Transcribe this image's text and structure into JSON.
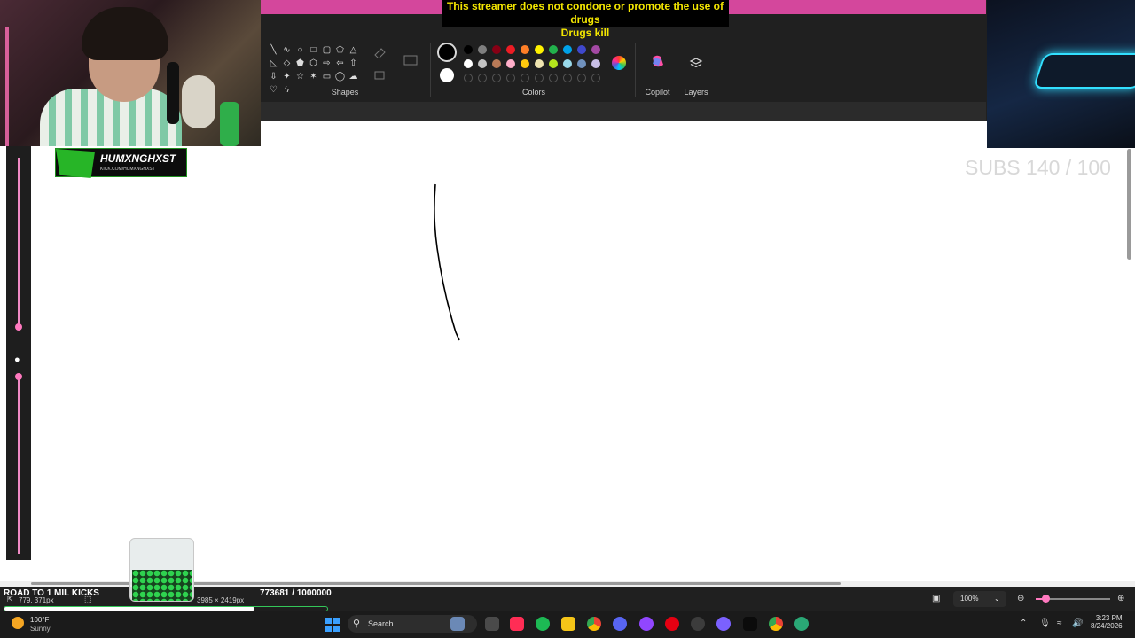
{
  "overlay": {
    "disclaimer_line1": "This streamer does not condone or promote the use of drugs",
    "disclaimer_line2": "Drugs kill",
    "channel_name": "HUMXNGHXST",
    "channel_url": "KICK.COM/HUMXNGHXST",
    "subs_goal": "SUBS 140 / 100",
    "kicks_goal_label": "ROAD TO 1 MIL KICKS",
    "kicks_goal_count": "773681 / 1000000",
    "kicks_goal_progress": 0.7737
  },
  "ribbon": {
    "shapes_label": "Shapes",
    "colors_label": "Colors",
    "copilot_label": "Copilot",
    "layers_label": "Layers",
    "colors_row1": [
      "#000000",
      "#7f7f7f",
      "#880015",
      "#ed1c24",
      "#ff7f27",
      "#fff200",
      "#22b14c",
      "#00a2e8",
      "#3f48cc",
      "#a349a4"
    ],
    "colors_row2": [
      "#ffffff",
      "#c3c3c3",
      "#b97a57",
      "#ffaec9",
      "#ffc90e",
      "#efe4b0",
      "#b5e61d",
      "#99d9ea",
      "#7092be",
      "#c8bfe7"
    ],
    "shape_icons": [
      "line-icon",
      "curve-icon",
      "oval-icon",
      "rectangle-icon",
      "rounded-rectangle-icon",
      "polygon-icon",
      "triangle-icon",
      "right-triangle-icon",
      "diamond-icon",
      "pentagon-icon",
      "hexagon-icon",
      "right-arrow-icon",
      "left-arrow-icon",
      "up-arrow-icon",
      "down-arrow-icon",
      "four-point-star-icon",
      "five-point-star-icon",
      "six-point-star-icon",
      "rounded-callout-icon",
      "oval-callout-icon",
      "cloud-callout-icon",
      "heart-icon",
      "lightning-icon"
    ]
  },
  "statusbar": {
    "cursor_position": "779, 371px",
    "canvas_size": "3985 × 2419px",
    "zoom": "100%"
  },
  "taskbar": {
    "temperature": "100°F",
    "weather": "Sunny",
    "search_placeholder": "Search",
    "time": "3:23 PM",
    "date": "8/24/2026"
  }
}
